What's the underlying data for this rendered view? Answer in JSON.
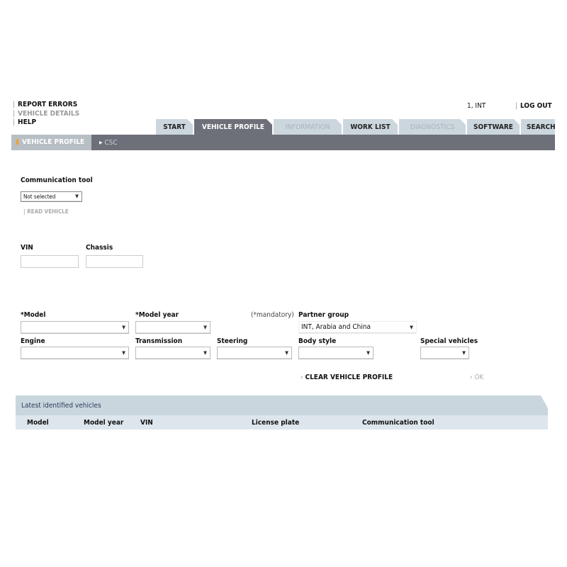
{
  "top_links": {
    "report_errors": "REPORT ERRORS",
    "vehicle_details": "VEHICLE DETAILS",
    "help": "HELP"
  },
  "user": {
    "name": "1, INT",
    "logout": "LOG OUT"
  },
  "tabs": [
    {
      "label": "START",
      "state": "normal"
    },
    {
      "label": "VEHICLE PROFILE",
      "state": "active"
    },
    {
      "label": "INFORMATION",
      "state": "disabled"
    },
    {
      "label": "WORK LIST",
      "state": "normal"
    },
    {
      "label": "DIAGNOSTICS",
      "state": "disabled"
    },
    {
      "label": "SOFTWARE",
      "state": "normal"
    },
    {
      "label": "SEARCH",
      "state": "normal"
    }
  ],
  "subnav": {
    "active": "VEHICLE PROFILE",
    "other": "CSC"
  },
  "comm": {
    "label": "Communication tool",
    "value": "Not selected",
    "read": "READ VEHICLE"
  },
  "vin": {
    "label": "VIN",
    "value": ""
  },
  "chassis": {
    "label": "Chassis",
    "value": ""
  },
  "fields": {
    "model": "*Model",
    "model_year": "*Model year",
    "mandatory": "(*mandatory)",
    "partner_group": "Partner group",
    "partner_value": "INT, Arabia and China",
    "engine": "Engine",
    "transmission": "Transmission",
    "steering": "Steering",
    "body_style": "Body style",
    "special": "Special vehicles"
  },
  "actions": {
    "clear": "CLEAR VEHICLE PROFILE",
    "ok": "OK"
  },
  "latest": {
    "title": "Latest identified vehicles",
    "columns": [
      "Model",
      "Model year",
      "VIN",
      "License plate",
      "Communication tool"
    ]
  },
  "colors": {
    "nav_dark": "#6d7078",
    "tab_light": "#ccd6dd",
    "panel": "#c9d6de",
    "accent": "#f0a030"
  }
}
